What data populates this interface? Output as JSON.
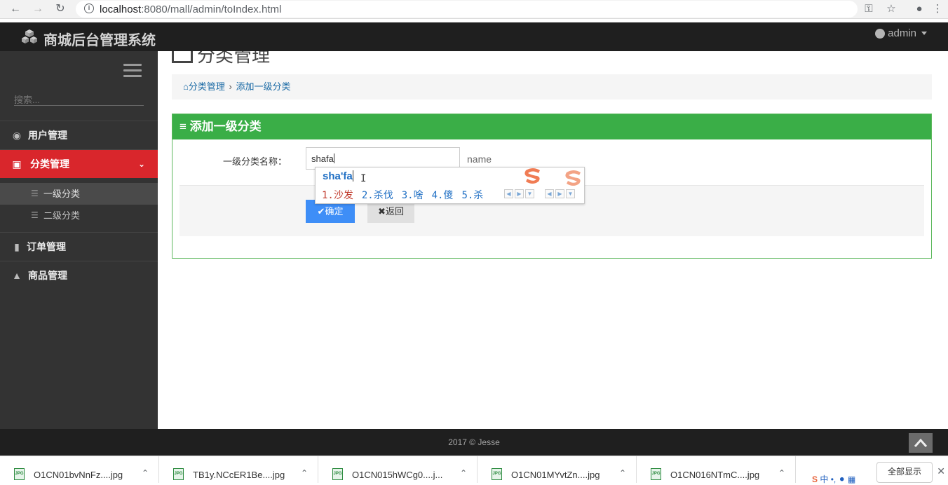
{
  "browser": {
    "url_host": "localhost",
    "url_rest": ":8080/mall/admin/toIndex.html"
  },
  "header": {
    "app_title": "商城后台管理系统",
    "user": "admin"
  },
  "sidebar": {
    "search_placeholder": "搜索...",
    "items": [
      {
        "label": "用户管理"
      },
      {
        "label": "分类管理"
      },
      {
        "label": "订单管理"
      },
      {
        "label": "商品管理"
      }
    ],
    "subitems": [
      {
        "label": "一级分类"
      },
      {
        "label": "二级分类"
      }
    ]
  },
  "main": {
    "page_title": "分类管理",
    "breadcrumb": {
      "home": "分类管理",
      "current": "添加一级分类"
    },
    "panel": {
      "title": "添加一级分类",
      "field_label": "一级分类名称：",
      "field_value": "shafa",
      "field_hint": "name",
      "ok_label": "确定",
      "back_label": "返回"
    }
  },
  "ime": {
    "composition": "sha'fa",
    "candidates": [
      "1.沙发",
      "2.杀伐",
      "3.啥",
      "4.傻",
      "5.杀"
    ]
  },
  "footer": {
    "text": "2017 © Jesse"
  },
  "downloads": [
    {
      "name": "O1CN01bvNnFz....jpg"
    },
    {
      "name": "TB1y.NCcER1Be....jpg"
    },
    {
      "name": "O1CN015hWCg0....j..."
    },
    {
      "name": "O1CN01MYvtZn....jpg"
    },
    {
      "name": "O1CN016NTmC....jpg"
    }
  ],
  "shelf": {
    "show_all": "全部显示",
    "tray_text": "中"
  },
  "colors": {
    "sidebar_bg": "#333333",
    "active_red": "#d9262c",
    "panel_green": "#3aae47",
    "primary_blue": "#3e8ef7"
  }
}
